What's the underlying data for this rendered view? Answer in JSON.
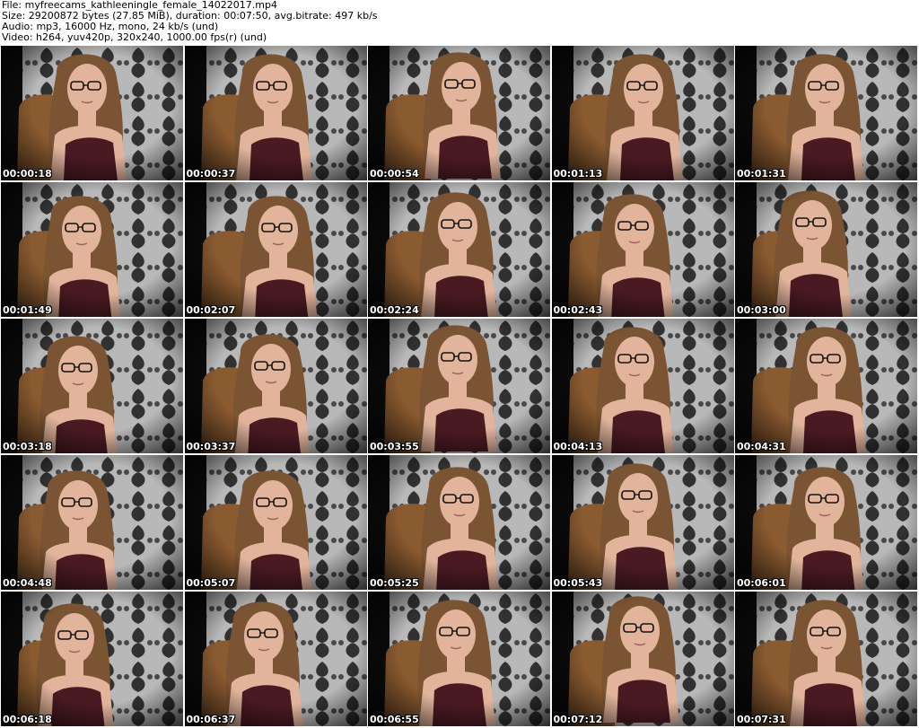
{
  "header": {
    "file": "File: myfreecams_kathleeningle_female_14022017.mp4",
    "size": "Size: 29200872 bytes (27.85 MiB), duration: 00:07:50, avg.bitrate: 497 kb/s",
    "audio": "Audio: mp3, 16000 Hz, mono, 24 kb/s (und)",
    "video": "Video: h264, yuv420p, 320x240, 1000.00 fps(r) (und)"
  },
  "thumbnails": [
    {
      "timestamp": "00:00:18"
    },
    {
      "timestamp": "00:00:37"
    },
    {
      "timestamp": "00:00:54"
    },
    {
      "timestamp": "00:01:13"
    },
    {
      "timestamp": "00:01:31"
    },
    {
      "timestamp": "00:01:49"
    },
    {
      "timestamp": "00:02:07"
    },
    {
      "timestamp": "00:02:24"
    },
    {
      "timestamp": "00:02:43"
    },
    {
      "timestamp": "00:03:00"
    },
    {
      "timestamp": "00:03:18"
    },
    {
      "timestamp": "00:03:37"
    },
    {
      "timestamp": "00:03:55"
    },
    {
      "timestamp": "00:04:13"
    },
    {
      "timestamp": "00:04:31"
    },
    {
      "timestamp": "00:04:48"
    },
    {
      "timestamp": "00:05:07"
    },
    {
      "timestamp": "00:05:25"
    },
    {
      "timestamp": "00:05:43"
    },
    {
      "timestamp": "00:06:01"
    },
    {
      "timestamp": "00:06:18"
    },
    {
      "timestamp": "00:06:37"
    },
    {
      "timestamp": "00:06:55"
    },
    {
      "timestamp": "00:07:12"
    },
    {
      "timestamp": "00:07:31"
    }
  ],
  "colors": {
    "wallpaper_light": "#b8b8b8",
    "wallpaper_dark": "#1a1a1a",
    "hair": "#7a5433",
    "skin": "#e2b49c",
    "top": "#4a1a22",
    "chair": "#8a5a30"
  }
}
